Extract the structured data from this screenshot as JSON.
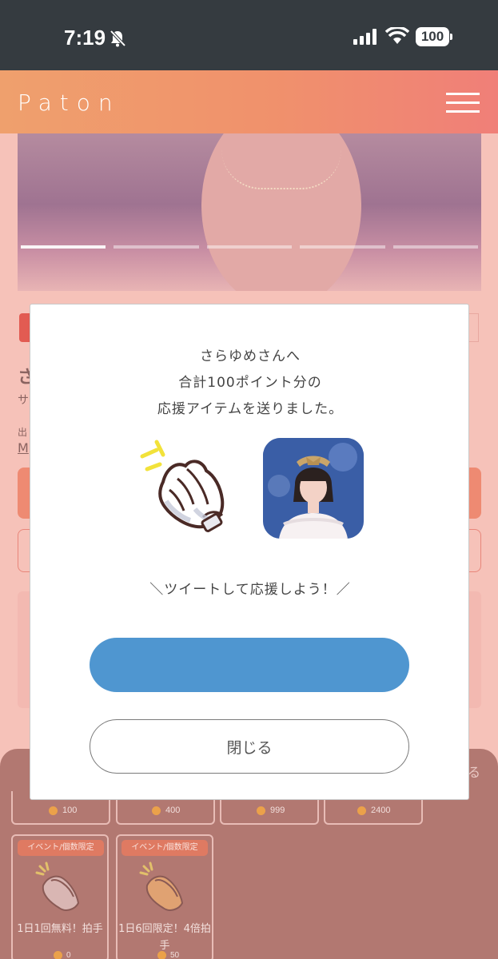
{
  "status_bar": {
    "time": "7:19",
    "battery": "100"
  },
  "header": {
    "logo": "Paton"
  },
  "background": {
    "char1": "さ",
    "char2": "サ",
    "char3": "出",
    "char4": "M"
  },
  "sheet": {
    "close_tail": "る",
    "gifts_top_row": [
      {
        "price": "100"
      },
      {
        "price": "400"
      },
      {
        "price": "999"
      },
      {
        "price": "2400"
      }
    ],
    "gifts_second_row": [
      {
        "badge": "イベント/個数限定",
        "name": "1日1回無料！拍手",
        "price": "0"
      },
      {
        "badge": "イベント/個数限定",
        "name": "1日6回限定！4倍拍手",
        "price": "50"
      }
    ]
  },
  "modal": {
    "line1": "さらゆめさんへ",
    "line2": "合計100ポイント分の",
    "line3": "応援アイテムを送りました。",
    "tweet_prompt": "＼ツイートして応援しよう！／",
    "tweet_button": "",
    "close_button": "閉じる"
  }
}
